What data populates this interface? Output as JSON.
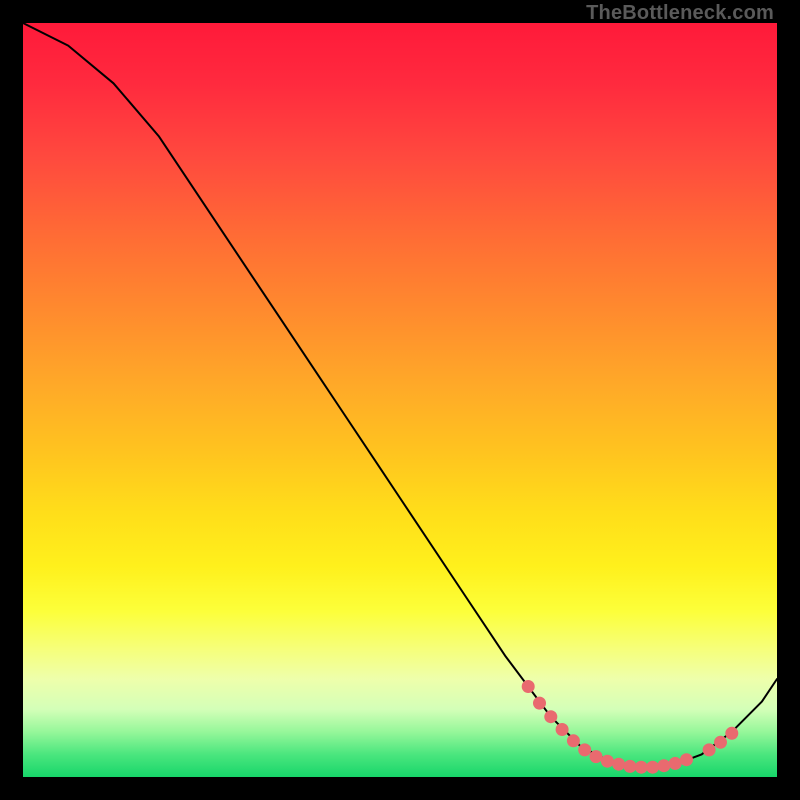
{
  "watermark": "TheBottleneck.com",
  "chart_data": {
    "type": "line",
    "title": "",
    "xlabel": "",
    "ylabel": "",
    "xlim": [
      0,
      100
    ],
    "ylim": [
      0,
      100
    ],
    "grid": false,
    "legend": false,
    "curve": [
      {
        "x": 0,
        "y": 100
      },
      {
        "x": 6,
        "y": 97
      },
      {
        "x": 12,
        "y": 92
      },
      {
        "x": 18,
        "y": 85
      },
      {
        "x": 26,
        "y": 73
      },
      {
        "x": 34,
        "y": 61
      },
      {
        "x": 42,
        "y": 49
      },
      {
        "x": 50,
        "y": 37
      },
      {
        "x": 58,
        "y": 25
      },
      {
        "x": 64,
        "y": 16
      },
      {
        "x": 70,
        "y": 8
      },
      {
        "x": 74,
        "y": 4
      },
      {
        "x": 78,
        "y": 2
      },
      {
        "x": 82,
        "y": 1.2
      },
      {
        "x": 86,
        "y": 1.5
      },
      {
        "x": 90,
        "y": 3
      },
      {
        "x": 94,
        "y": 6
      },
      {
        "x": 98,
        "y": 10
      },
      {
        "x": 100,
        "y": 13
      }
    ],
    "markers": [
      {
        "x": 67,
        "y": 12.0
      },
      {
        "x": 68.5,
        "y": 9.8
      },
      {
        "x": 70,
        "y": 8.0
      },
      {
        "x": 71.5,
        "y": 6.3
      },
      {
        "x": 73,
        "y": 4.8
      },
      {
        "x": 74.5,
        "y": 3.6
      },
      {
        "x": 76,
        "y": 2.7
      },
      {
        "x": 77.5,
        "y": 2.1
      },
      {
        "x": 79,
        "y": 1.7
      },
      {
        "x": 80.5,
        "y": 1.4
      },
      {
        "x": 82,
        "y": 1.3
      },
      {
        "x": 83.5,
        "y": 1.3
      },
      {
        "x": 85,
        "y": 1.5
      },
      {
        "x": 86.5,
        "y": 1.8
      },
      {
        "x": 88,
        "y": 2.3
      },
      {
        "x": 91,
        "y": 3.6
      },
      {
        "x": 92.5,
        "y": 4.6
      },
      {
        "x": 94,
        "y": 5.8
      }
    ],
    "colors": {
      "curve": "#000000",
      "marker": "#e96a6f",
      "gradient_top": "#ff1a3a",
      "gradient_bottom": "#17d66a"
    }
  }
}
